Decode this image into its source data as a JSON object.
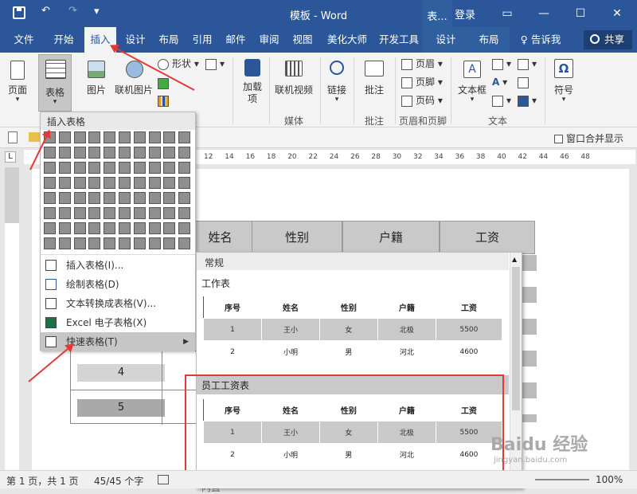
{
  "title_bar": {
    "doc_title": "模板 - Word",
    "context_tab_title": "表...",
    "login": "登录",
    "undo": "↶",
    "redo": "↷",
    "more": "▾"
  },
  "window_buttons": {
    "ribbon_display": "▭",
    "minimize": "—",
    "maximize": "☐",
    "close": "✕"
  },
  "tabs": [
    "文件",
    "开始",
    "插入",
    "设计",
    "布局",
    "引用",
    "邮件",
    "审阅",
    "视图",
    "美化大师",
    "开发工具"
  ],
  "context_tabs": [
    "设计",
    "布局"
  ],
  "tell_me": "告诉我",
  "share": "共享",
  "ribbon": {
    "page": "页面",
    "table": "表格",
    "picture": "图片",
    "online_picture": "联机图片",
    "shapes": "形状",
    "addins": "加载\n项",
    "online_video": "联机视频",
    "link": "链接",
    "comment": "批注",
    "header": "页眉",
    "footer": "页脚",
    "page_number": "页码",
    "textbox": "文本框",
    "symbol": "符号",
    "groups": {
      "media": "媒体",
      "comments": "批注",
      "header_footer": "页眉和页脚",
      "text": "文本"
    }
  },
  "qrow": {
    "window_merge": "窗口合并显示"
  },
  "ruler_numbers": [
    "12",
    "14",
    "16",
    "18",
    "20",
    "22",
    "24",
    "26",
    "28",
    "30",
    "32",
    "34",
    "36",
    "38",
    "40",
    "42",
    "44",
    "46",
    "48"
  ],
  "dropdown": {
    "header": "插入表格",
    "items": [
      {
        "label": "插入表格(I)..."
      },
      {
        "label": "绘制表格(D)"
      },
      {
        "label": "文本转换成表格(V)..."
      },
      {
        "label": "Excel 电子表格(X)"
      },
      {
        "label": "快速表格(T)"
      }
    ]
  },
  "flyout": {
    "section": "常规",
    "tables": [
      {
        "title": "工作表",
        "headers": [
          "序号",
          "姓名",
          "性别",
          "户籍",
          "工资"
        ],
        "rows": [
          [
            "1",
            "王小",
            "女",
            "北极",
            "5500"
          ],
          [
            "2",
            "小明",
            "男",
            "河北",
            "4600"
          ]
        ]
      },
      {
        "title": "员工工资表",
        "headers": [
          "序号",
          "姓名",
          "性别",
          "户籍",
          "工资"
        ],
        "rows": [
          [
            "1",
            "王小",
            "女",
            "北极",
            "5500"
          ],
          [
            "2",
            "小明",
            "男",
            "河北",
            "4600"
          ]
        ]
      }
    ],
    "next_label": "内置"
  },
  "doc_table": {
    "headers": [
      "姓名",
      "性别",
      "户籍",
      "工资"
    ],
    "row_numbers": [
      "4",
      "5"
    ]
  },
  "status": {
    "page": "第 1 页，共 1 页",
    "words": "45/45 个字",
    "zoom": "100%"
  },
  "watermark": {
    "brand": "Baidu 经验",
    "url": "jingyan.baidu.com"
  },
  "colors": {
    "accent": "#2b579a",
    "highlight": "#e53935"
  }
}
